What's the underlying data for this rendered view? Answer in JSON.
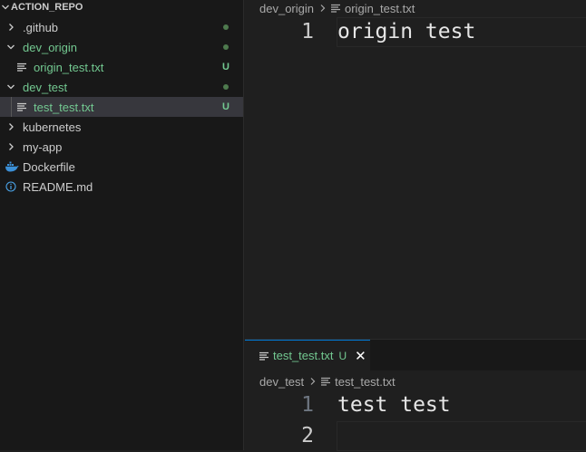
{
  "explorer": {
    "root_label": "ACTION_REPO",
    "items": [
      {
        "label": ".github",
        "kind": "folder",
        "expanded": false,
        "status": "dot"
      },
      {
        "label": "dev_origin",
        "kind": "folder",
        "expanded": true,
        "status": "dot"
      },
      {
        "label": "origin_test.txt",
        "kind": "file",
        "status": "U"
      },
      {
        "label": "dev_test",
        "kind": "folder",
        "expanded": true,
        "status": "dot"
      },
      {
        "label": "test_test.txt",
        "kind": "file",
        "status": "U",
        "selected": true
      },
      {
        "label": "kubernetes",
        "kind": "folder",
        "expanded": false
      },
      {
        "label": "my-app",
        "kind": "folder",
        "expanded": false
      },
      {
        "label": "Dockerfile",
        "kind": "file",
        "icon": "docker-icon"
      },
      {
        "label": "README.md",
        "kind": "file",
        "icon": "info-icon"
      }
    ]
  },
  "editor_top": {
    "breadcrumb": {
      "folder": "dev_origin",
      "file": "origin_test.txt"
    },
    "lines": [
      {
        "number": "1",
        "text": "origin test"
      }
    ]
  },
  "editor_bottom": {
    "tab": {
      "label": "test_test.txt",
      "badge": "U",
      "close": "✕"
    },
    "breadcrumb": {
      "folder": "dev_test",
      "file": "test_test.txt"
    },
    "lines": [
      {
        "number": "1",
        "text": "test test"
      },
      {
        "number": "2",
        "text": ""
      }
    ]
  },
  "colors": {
    "untracked": "#73c991",
    "selection": "#37373d",
    "accent": "#0078d4"
  }
}
